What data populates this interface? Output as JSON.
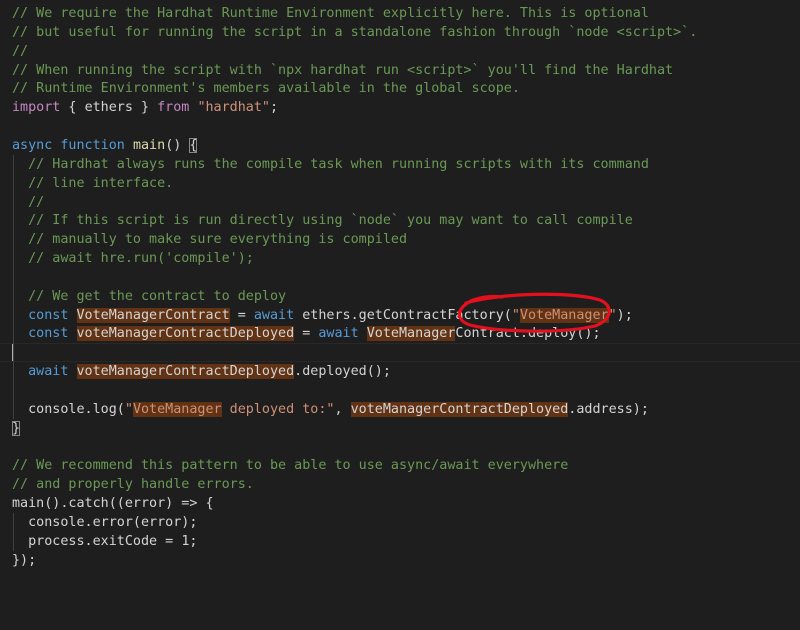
{
  "lines": [
    [
      {
        "t": "// We require the Hardhat Runtime Environment explicitly here. This is optional",
        "c": "cm"
      }
    ],
    [
      {
        "t": "// but useful for running the script in a standalone fashion through `node <script>`.",
        "c": "cm"
      }
    ],
    [
      {
        "t": "//",
        "c": "cm"
      }
    ],
    [
      {
        "t": "// When running the script with `npx hardhat run <script>` you'll find the Hardhat",
        "c": "cm"
      }
    ],
    [
      {
        "t": "// Runtime Environment's members available in the global scope.",
        "c": "cm"
      }
    ],
    [
      {
        "t": "import",
        "c": "imp"
      },
      {
        "t": " { ",
        "c": ""
      },
      {
        "t": "ethers",
        "c": ""
      },
      {
        "t": " } ",
        "c": ""
      },
      {
        "t": "from",
        "c": "imp"
      },
      {
        "t": " ",
        "c": ""
      },
      {
        "t": "\"hardhat\"",
        "c": "str"
      },
      {
        "t": ";",
        "c": ""
      }
    ],
    [],
    [
      {
        "t": "async",
        "c": "kw"
      },
      {
        "t": " ",
        "c": ""
      },
      {
        "t": "function",
        "c": "kw"
      },
      {
        "t": " ",
        "c": ""
      },
      {
        "t": "main",
        "c": "fn"
      },
      {
        "t": "() ",
        "c": ""
      },
      {
        "t": "{",
        "c": "bm"
      }
    ],
    [
      {
        "t": "  // Hardhat always runs the compile task when running scripts with its command",
        "c": "cm"
      }
    ],
    [
      {
        "t": "  // line interface.",
        "c": "cm"
      }
    ],
    [
      {
        "t": "  //",
        "c": "cm"
      }
    ],
    [
      {
        "t": "  // If this script is run directly using `node` you may want to call compile",
        "c": "cm"
      }
    ],
    [
      {
        "t": "  // manually to make sure everything is compiled",
        "c": "cm"
      }
    ],
    [
      {
        "t": "  // await hre.run('compile');",
        "c": "cm"
      }
    ],
    [],
    [
      {
        "t": "  // We get the contract to deploy",
        "c": "cm"
      }
    ],
    [
      {
        "t": "  ",
        "c": ""
      },
      {
        "t": "const",
        "c": "kw"
      },
      {
        "t": " ",
        "c": ""
      },
      {
        "t": "VoteManagerContract",
        "c": "hl"
      },
      {
        "t": " = ",
        "c": ""
      },
      {
        "t": "await",
        "c": "kw"
      },
      {
        "t": " ethers.getContractFactory(",
        "c": ""
      },
      {
        "t": "\"",
        "c": "str"
      },
      {
        "t": "VoteManager",
        "c": "str hl"
      },
      {
        "t": "\"",
        "c": "str"
      },
      {
        "t": ");",
        "c": ""
      }
    ],
    [
      {
        "t": "  ",
        "c": ""
      },
      {
        "t": "const",
        "c": "kw"
      },
      {
        "t": " ",
        "c": ""
      },
      {
        "t": "voteManagerContractDeployed",
        "c": "hl"
      },
      {
        "t": " = ",
        "c": ""
      },
      {
        "t": "await",
        "c": "kw"
      },
      {
        "t": " ",
        "c": ""
      },
      {
        "t": "VoteManager",
        "c": "hl"
      },
      {
        "t": "Contract.deploy();",
        "c": ""
      }
    ],
    [],
    [
      {
        "t": "  ",
        "c": ""
      },
      {
        "t": "await",
        "c": "kw"
      },
      {
        "t": " ",
        "c": ""
      },
      {
        "t": "voteManagerContractDeployed",
        "c": "hl"
      },
      {
        "t": ".deployed();",
        "c": ""
      }
    ],
    [],
    [
      {
        "t": "  console.log(",
        "c": ""
      },
      {
        "t": "\"",
        "c": "str"
      },
      {
        "t": "VoteManager",
        "c": "str hl"
      },
      {
        "t": " deployed to:\"",
        "c": "str"
      },
      {
        "t": ", ",
        "c": ""
      },
      {
        "t": "voteManagerContractDeployed",
        "c": "hl"
      },
      {
        "t": ".address);",
        "c": ""
      }
    ],
    [
      {
        "t": "}",
        "c": "bm"
      }
    ],
    [],
    [
      {
        "t": "// We recommend this pattern to be able to use async/await everywhere",
        "c": "cm"
      }
    ],
    [
      {
        "t": "// and properly handle errors.",
        "c": "cm"
      }
    ],
    [
      {
        "t": "main().catch((error) => {",
        "c": ""
      }
    ],
    [
      {
        "t": "  console.error(error);",
        "c": ""
      }
    ],
    [
      {
        "t": "  process.exitCode = ",
        "c": ""
      },
      {
        "t": "1",
        "c": ""
      },
      {
        "t": ";",
        "c": ""
      }
    ],
    [
      {
        "t": "});",
        "c": ""
      }
    ]
  ],
  "cursor_line": 18,
  "annotation": {
    "color": "#e3101e",
    "shape": "hand-drawn-ellipse"
  }
}
